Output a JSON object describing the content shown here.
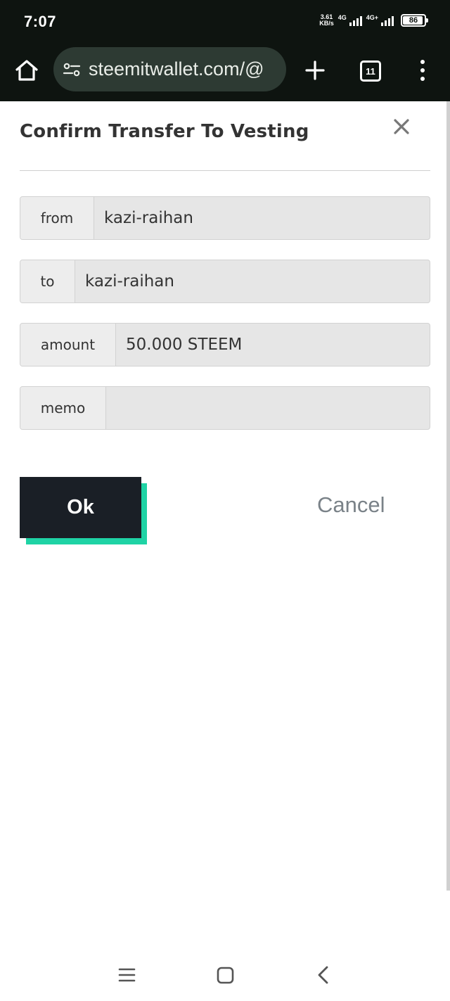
{
  "status_bar": {
    "time": "7:07",
    "net_speed_value": "3.61",
    "net_speed_unit": "KB/s",
    "net_type_1": "4G",
    "net_type_2": "4G+",
    "battery_level": "86"
  },
  "browser": {
    "url": "steemitwallet.com/@",
    "tab_count": "11"
  },
  "dialog": {
    "title": "Confirm Transfer To Vesting",
    "fields": {
      "from": {
        "label": "from",
        "value": "kazi-raihan"
      },
      "to": {
        "label": "to",
        "value": "kazi-raihan"
      },
      "amount": {
        "label": "amount",
        "value": "50.000 STEEM"
      },
      "memo": {
        "label": "memo",
        "value": ""
      }
    },
    "ok_label": "Ok",
    "cancel_label": "Cancel"
  },
  "colors": {
    "ok_button_bg": "#1a1f26",
    "ok_button_accent": "#1fd3a5",
    "browser_chrome": "#0e1410",
    "url_bar_bg": "#2d3a33"
  },
  "icons": [
    "home-icon",
    "site-settings-icon",
    "new-tab-icon",
    "tab-switcher-icon",
    "more-menu-icon",
    "close-icon",
    "recent-apps-icon",
    "home-nav-icon",
    "back-icon"
  ]
}
